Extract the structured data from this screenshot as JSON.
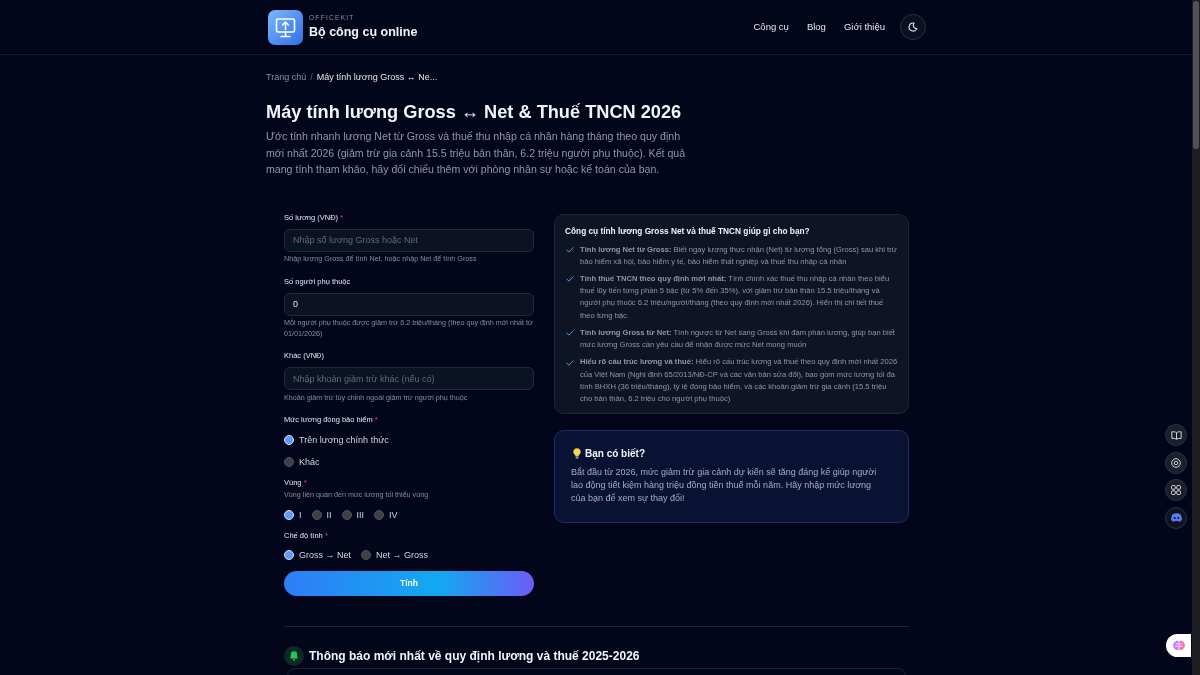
{
  "header": {
    "brand_caption": "OFFICEKIT",
    "brand_title": "Bộ công cụ online",
    "nav": [
      {
        "label": "Công cụ"
      },
      {
        "label": "Blog"
      },
      {
        "label": "Giới thiệu"
      }
    ]
  },
  "breadcrumb": {
    "separator": "/",
    "items": [
      {
        "label": "Trang chủ",
        "current": false
      },
      {
        "label": "Máy tính lương Gross ↔ Ne...",
        "current": true
      }
    ]
  },
  "title": "Máy tính lương Gross ↔ Net & Thuế TNCN 2026",
  "description": "Ước tính nhanh lương Net từ Gross và thuế thu nhập cá nhân hàng tháng theo quy định mới nhất 2026 (giảm trừ gia cảnh 15.5 triệu bản thân, 6.2 triệu người phụ thuộc). Kết quả mang tính tham khảo, hãy đối chiếu thêm với phòng nhân sự hoặc kế toán của bạn.",
  "form": {
    "required_mark": "*",
    "fields": [
      {
        "kind": "input",
        "label": "Số lương (VNĐ)",
        "required": true,
        "placeholder": "Nhập số lương Gross hoặc Net",
        "hint": "Nhập lương Gross để tính Net, hoặc nhập Net để tính Gross"
      },
      {
        "kind": "input",
        "label": "Số người phụ thuộc",
        "required": false,
        "value": "0",
        "hint": "Mỗi người phụ thuộc được giảm trừ 6.2 triệu/tháng (theo quy định mới nhất từ 01/01/2026)"
      },
      {
        "kind": "input",
        "label": "Khác (VNĐ)",
        "required": false,
        "placeholder": "Nhập khoản giảm trừ khác (nếu có)",
        "hint": "Khoản giảm trừ tùy chỉnh ngoài giảm trừ người phụ thuộc"
      },
      {
        "kind": "radio_list",
        "label": "Mức lương đóng bảo hiểm",
        "required": true,
        "options": [
          {
            "label": "Trên lương chính thức",
            "selected": true
          },
          {
            "label": "Khác",
            "selected": false
          }
        ]
      },
      {
        "kind": "radio_row",
        "label": "Vùng",
        "required": true,
        "hint": "Vùng liên quan đến mức lương tối thiểu vùng",
        "options": [
          {
            "label": "I",
            "selected": true
          },
          {
            "label": "II",
            "selected": false
          },
          {
            "label": "III",
            "selected": false
          },
          {
            "label": "IV",
            "selected": false
          }
        ]
      },
      {
        "kind": "radio_row",
        "label": "Chế độ tính",
        "required": true,
        "options": [
          {
            "label": "Gross → Net",
            "selected": true
          },
          {
            "label": "Net → Gross",
            "selected": false
          }
        ]
      }
    ],
    "submit_label": "Tính"
  },
  "info_card": {
    "title": "Công cụ tính lương Gross Net và thuế TNCN giúp gì cho bạn?",
    "items": [
      "**Tính lương Net từ Gross:** Biết ngay lương thực nhận (Net) từ lương tổng (Gross) sau khi trừ bảo hiểm xã hội, bảo hiểm y tế, bảo hiểm thất nghiệp và thuế thu nhập cá nhân",
      "**Tính thuế TNCN theo quy định mới nhất:** Tính chính xác thuế thu nhập cá nhân theo biểu thuế lũy tiến từng phần 5 bậc (từ 5% đến 35%), với giảm trừ bản thân 15.5 triệu/tháng và người phụ thuộc 6.2 triệu/người/tháng (theo quy định mới nhất 2026). Hiển thị chi tiết thuế theo từng bậc.",
      "**Tính lương Gross từ Net:** Tính ngược từ Net sang Gross khi đàm phán lương, giúp bạn biết mức lương Gross cần yêu cầu để nhận được mức Net mong muốn",
      "**Hiểu rõ cấu trúc lương và thuế:** Hiểu rõ cấu trúc lương và thuế theo quy định mới nhất 2026 của Việt Nam (Nghị định 65/2013/NĐ-CP và các văn bản sửa đổi), bao gồm mức lương tối đa tính BHXH (36 triệu/tháng), tỷ lệ đóng bảo hiểm, và các khoản giảm trừ gia cảnh (15.5 triệu cho bản thân, 6.2 triệu cho người phụ thuộc)"
    ]
  },
  "tip_card": {
    "title": "Bạn có biết?",
    "text": "Bắt đầu từ 2026, mức giảm trừ gia cảnh dự kiến sẽ tăng đáng kể giúp người lao động tiết kiệm hàng triệu đồng tiền thuế mỗi năm. Hãy nhập mức lương của bạn để xem sự thay đổi!"
  },
  "news_section": {
    "title": "Thông báo mới nhất về quy định lương và thuế 2025-2026"
  }
}
